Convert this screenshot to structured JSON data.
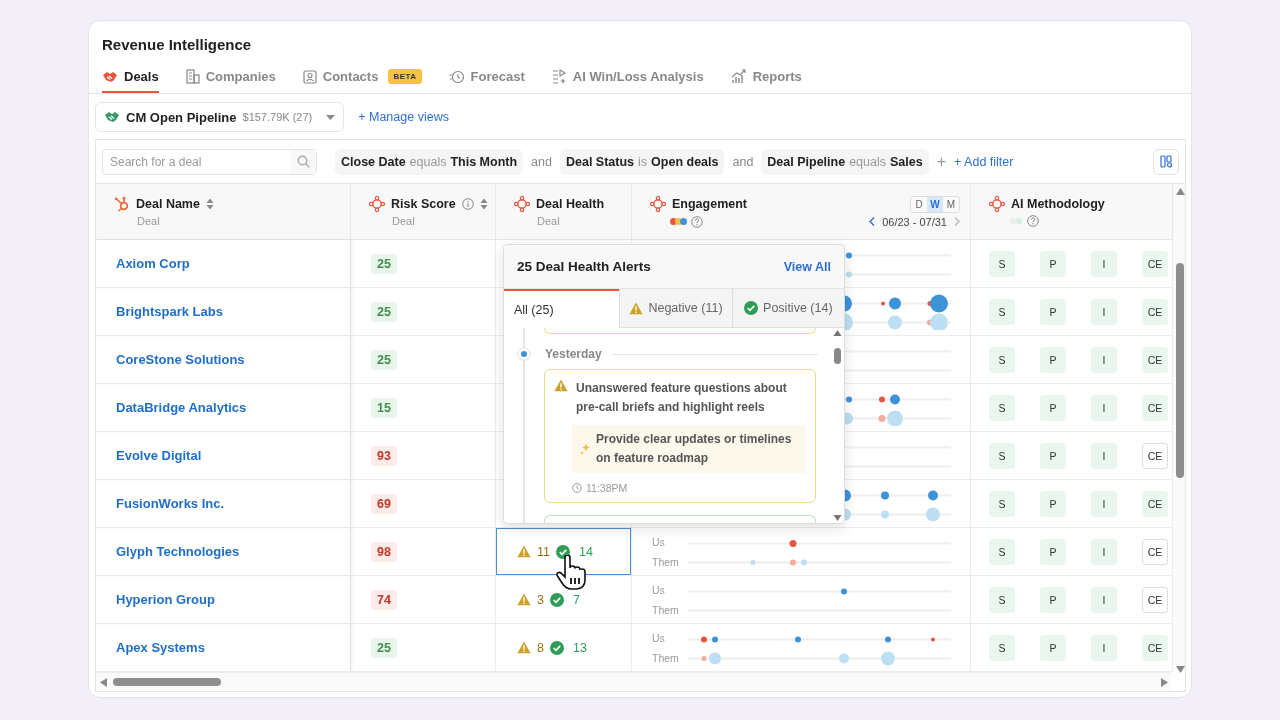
{
  "app": {
    "title": "Revenue Intelligence"
  },
  "tabs": [
    {
      "label": "Deals",
      "selected": true,
      "kind": "deals"
    },
    {
      "label": "Companies",
      "selected": false,
      "kind": "companies"
    },
    {
      "label": "Contacts",
      "selected": false,
      "kind": "contacts",
      "badge": "BETA"
    },
    {
      "label": "Forecast",
      "selected": false,
      "kind": "forecast"
    },
    {
      "label": "AI Win/Loss Analysis",
      "selected": false,
      "kind": "winloss"
    },
    {
      "label": "Reports",
      "selected": false,
      "kind": "reports"
    }
  ],
  "view": {
    "name": "CM Open Pipeline",
    "summary": "$157.79K (27)",
    "manage": "+ Manage views"
  },
  "search": {
    "placeholder": "Search for a deal"
  },
  "filters": [
    {
      "field": "Close Date",
      "op": "equals",
      "value": "This Month"
    },
    {
      "joiner": "and",
      "field": "Deal Status",
      "op": "is",
      "value": "Open deals"
    },
    {
      "joiner": "and",
      "field": "Deal Pipeline",
      "op": "equals",
      "value": "Sales"
    }
  ],
  "filter_plus": "+",
  "add_filter": "+ Add filter",
  "columns": [
    {
      "kind": "name",
      "title": "Deal Name",
      "sub": "Deal"
    },
    {
      "kind": "risk",
      "title": "Risk Score",
      "sub": "Deal"
    },
    {
      "kind": "health",
      "title": "Deal Health",
      "sub": "Deal"
    },
    {
      "kind": "engagement",
      "title": "Engagement",
      "periods": [
        {
          "label": "D",
          "selected": false
        },
        {
          "label": "W",
          "selected": true
        },
        {
          "label": "M",
          "selected": false
        }
      ],
      "range": "06/23 - 07/31"
    },
    {
      "kind": "methodology",
      "title": "AI Methodology"
    }
  ],
  "rows": [
    {
      "name": "Axiom Corp",
      "risk": "25",
      "kind": "low",
      "chips": [
        {
          "label": "S",
          "on": true
        },
        {
          "label": "P",
          "on": true
        },
        {
          "label": "I",
          "on": true
        },
        {
          "label": "CE",
          "on": true
        }
      ]
    },
    {
      "name": "Brightspark Labs",
      "risk": "25",
      "kind": "low",
      "chips": [
        {
          "label": "S",
          "on": true
        },
        {
          "label": "P",
          "on": true
        },
        {
          "label": "I",
          "on": true
        },
        {
          "label": "CE",
          "on": true
        }
      ]
    },
    {
      "name": "CoreStone Solutions",
      "risk": "25",
      "kind": "low",
      "chips": [
        {
          "label": "S",
          "on": true
        },
        {
          "label": "P",
          "on": true
        },
        {
          "label": "I",
          "on": true
        },
        {
          "label": "CE",
          "on": true
        }
      ]
    },
    {
      "name": "DataBridge Analytics",
      "risk": "15",
      "kind": "low",
      "chips": [
        {
          "label": "S",
          "on": true
        },
        {
          "label": "P",
          "on": true
        },
        {
          "label": "I",
          "on": true
        },
        {
          "label": "CE",
          "on": true
        }
      ]
    },
    {
      "name": "Evolve Digital",
      "risk": "93",
      "kind": "high",
      "chips": [
        {
          "label": "S",
          "on": true
        },
        {
          "label": "P",
          "on": true
        },
        {
          "label": "I",
          "on": true
        },
        {
          "label": "CE",
          "on": false
        }
      ]
    },
    {
      "name": "FusionWorks Inc.",
      "risk": "69",
      "kind": "high",
      "chips": [
        {
          "label": "S",
          "on": true
        },
        {
          "label": "P",
          "on": true
        },
        {
          "label": "I",
          "on": true
        },
        {
          "label": "CE",
          "on": true
        }
      ]
    },
    {
      "name": "Glyph Technologies",
      "risk": "98",
      "kind": "high",
      "health": {
        "negative": "11",
        "positive": "14",
        "selected": true
      },
      "us": "Us",
      "them": "Them",
      "chips": [
        {
          "label": "S",
          "on": true
        },
        {
          "label": "P",
          "on": true
        },
        {
          "label": "I",
          "on": true
        },
        {
          "label": "CE",
          "on": false
        }
      ]
    },
    {
      "name": "Hyperion Group",
      "risk": "74",
      "kind": "high",
      "health": {
        "negative": "3",
        "positive": "7",
        "selected": false
      },
      "us": "Us",
      "them": "Them",
      "chips": [
        {
          "label": "S",
          "on": true
        },
        {
          "label": "P",
          "on": true
        },
        {
          "label": "I",
          "on": true
        },
        {
          "label": "CE",
          "on": false
        }
      ]
    },
    {
      "name": "Apex Systems",
      "risk": "25",
      "kind": "low",
      "health": {
        "negative": "8",
        "positive": "13",
        "selected": false
      },
      "us": "Us",
      "them": "Them",
      "chips": [
        {
          "label": "S",
          "on": true
        },
        {
          "label": "P",
          "on": true
        },
        {
          "label": "I",
          "on": true
        },
        {
          "label": "CE",
          "on": true
        }
      ]
    }
  ],
  "popover": {
    "title": "25 Deal Health Alerts",
    "view_all": "View All",
    "tabs": [
      {
        "label": "All (25)",
        "selected": true,
        "kind": "all"
      },
      {
        "label": "Negative (11)",
        "selected": false,
        "kind": "negative"
      },
      {
        "label": "Positive (14)",
        "selected": false,
        "kind": "positive"
      }
    ],
    "day": "Yesterday",
    "alert": {
      "kind": "negative",
      "text": "Unanswered feature questions about pre-call briefs and highlight reels",
      "suggestion": "Provide clear updates or timelines on feature roadmap",
      "time": "11:38PM"
    }
  }
}
